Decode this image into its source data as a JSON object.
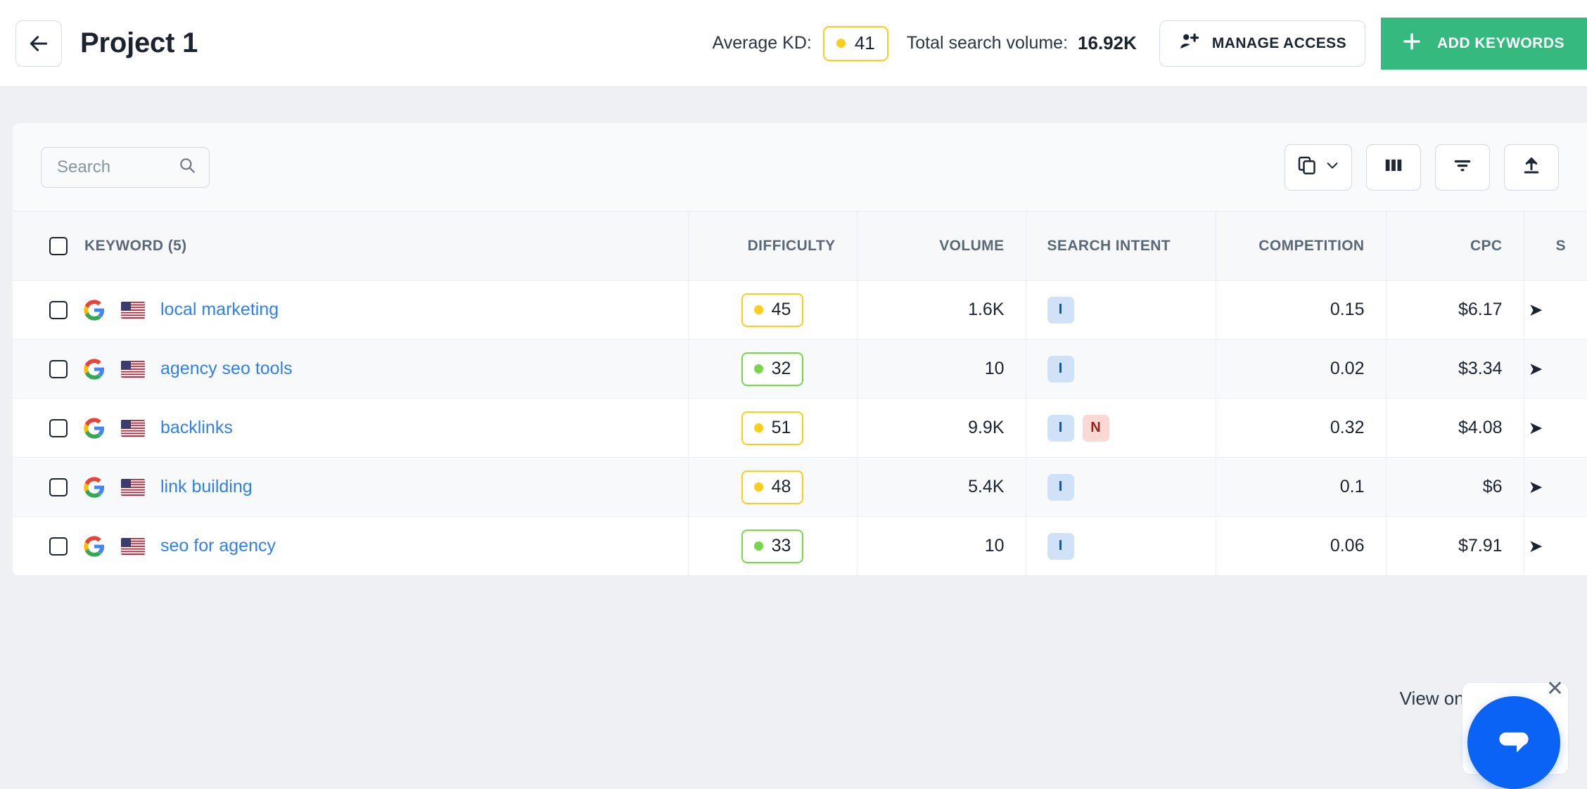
{
  "header": {
    "back_icon": "arrow-left-icon",
    "title": "Project 1",
    "avg_kd_label": "Average KD:",
    "avg_kd_value": "41",
    "avg_kd_color": "#fccd1a",
    "total_volume_label": "Total search volume:",
    "total_volume_value": "16.92K",
    "manage_access_label": "MANAGE ACCESS",
    "manage_access_icon": "person-add-icon",
    "add_keywords_label": "ADD KEYWORDS",
    "add_keywords_icon": "plus-icon",
    "add_keywords_color": "#35b97e"
  },
  "toolbar": {
    "search_placeholder": "Search",
    "search_value": "",
    "search_icon": "search-icon",
    "buttons": [
      {
        "name": "copy-dropdown-button",
        "icon": "copy-icon"
      },
      {
        "name": "columns-button",
        "icon": "columns-icon"
      },
      {
        "name": "filter-button",
        "icon": "filter-icon"
      },
      {
        "name": "export-button",
        "icon": "upload-icon"
      }
    ]
  },
  "table": {
    "columns": [
      {
        "key": "keyword",
        "label": "KEYWORD (5)",
        "align": "left"
      },
      {
        "key": "difficulty",
        "label": "DIFFICULTY",
        "align": "right"
      },
      {
        "key": "volume",
        "label": "VOLUME",
        "align": "right"
      },
      {
        "key": "intent",
        "label": "SEARCH INTENT",
        "align": "right"
      },
      {
        "key": "competition",
        "label": "COMPETITION",
        "align": "right"
      },
      {
        "key": "cpc",
        "label": "CPC",
        "align": "right"
      },
      {
        "key": "serp",
        "label": "S",
        "align": "right"
      }
    ],
    "rows": [
      {
        "keyword": "local marketing",
        "engine": "google-icon",
        "country": "us-flag-icon",
        "difficulty": "45",
        "difficulty_level": "medium",
        "volume": "1.6K",
        "intents": [
          "I"
        ],
        "competition": "0.15",
        "cpc": "$6.17"
      },
      {
        "keyword": "agency seo tools",
        "engine": "google-icon",
        "country": "us-flag-icon",
        "difficulty": "32",
        "difficulty_level": "easy",
        "volume": "10",
        "intents": [
          "I"
        ],
        "competition": "0.02",
        "cpc": "$3.34"
      },
      {
        "keyword": "backlinks",
        "engine": "google-icon",
        "country": "us-flag-icon",
        "difficulty": "51",
        "difficulty_level": "medium",
        "volume": "9.9K",
        "intents": [
          "I",
          "N"
        ],
        "competition": "0.32",
        "cpc": "$4.08"
      },
      {
        "keyword": "link building",
        "engine": "google-icon",
        "country": "us-flag-icon",
        "difficulty": "48",
        "difficulty_level": "medium",
        "volume": "5.4K",
        "intents": [
          "I"
        ],
        "competition": "0.1",
        "cpc": "$6"
      },
      {
        "keyword": "seo for agency",
        "engine": "google-icon",
        "country": "us-flag-icon",
        "difficulty": "33",
        "difficulty_level": "easy",
        "volume": "10",
        "intents": [
          "I"
        ],
        "competition": "0.06",
        "cpc": "$7.91"
      }
    ]
  },
  "footer": {
    "view_on_page_label": "View on page:",
    "chat_icon": "chat-bubble-icon",
    "close_icon": "close-icon"
  },
  "colors": {
    "accent_green": "#35b97e",
    "kd_yellow": "#fccd1a",
    "kd_green": "#78d64b",
    "link_blue": "#2f80ed",
    "intent_blue_bg": "#cfe2f7",
    "intent_red_bg": "#fad9d4",
    "chat_blue": "#0b63f6"
  }
}
